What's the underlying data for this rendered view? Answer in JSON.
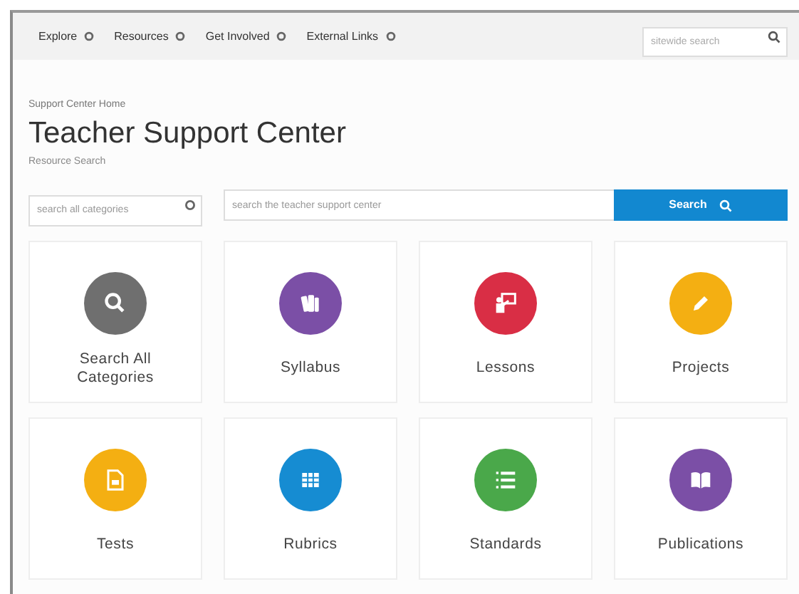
{
  "nav": {
    "items": [
      {
        "label": "Explore"
      },
      {
        "label": "Resources"
      },
      {
        "label": "Get Involved"
      },
      {
        "label": "External Links"
      }
    ],
    "search": {
      "placeholder": "sitewide search"
    }
  },
  "breadcrumb": "Support Center Home",
  "title": "Teacher Support Center",
  "subtitle": "Resource Search",
  "search": {
    "category_placeholder": "search all categories",
    "placeholder": "search the teacher support center",
    "button": "Search"
  },
  "categories": [
    {
      "label": "Search All Categories",
      "kind": "search",
      "color": "#6f6f6f"
    },
    {
      "label": "Syllabus",
      "kind": "books",
      "color": "#7b4fa6"
    },
    {
      "label": "Lessons",
      "kind": "teacher",
      "color": "#d92e45"
    },
    {
      "label": "Projects",
      "kind": "pencil",
      "color": "#f4af12"
    },
    {
      "label": "Tests",
      "kind": "document",
      "color": "#f4af12"
    },
    {
      "label": "Rubrics",
      "kind": "grid",
      "color": "#168cd2"
    },
    {
      "label": "Standards",
      "kind": "list",
      "color": "#4aa84a"
    },
    {
      "label": "Publications",
      "kind": "book",
      "color": "#7b4fa6"
    }
  ]
}
